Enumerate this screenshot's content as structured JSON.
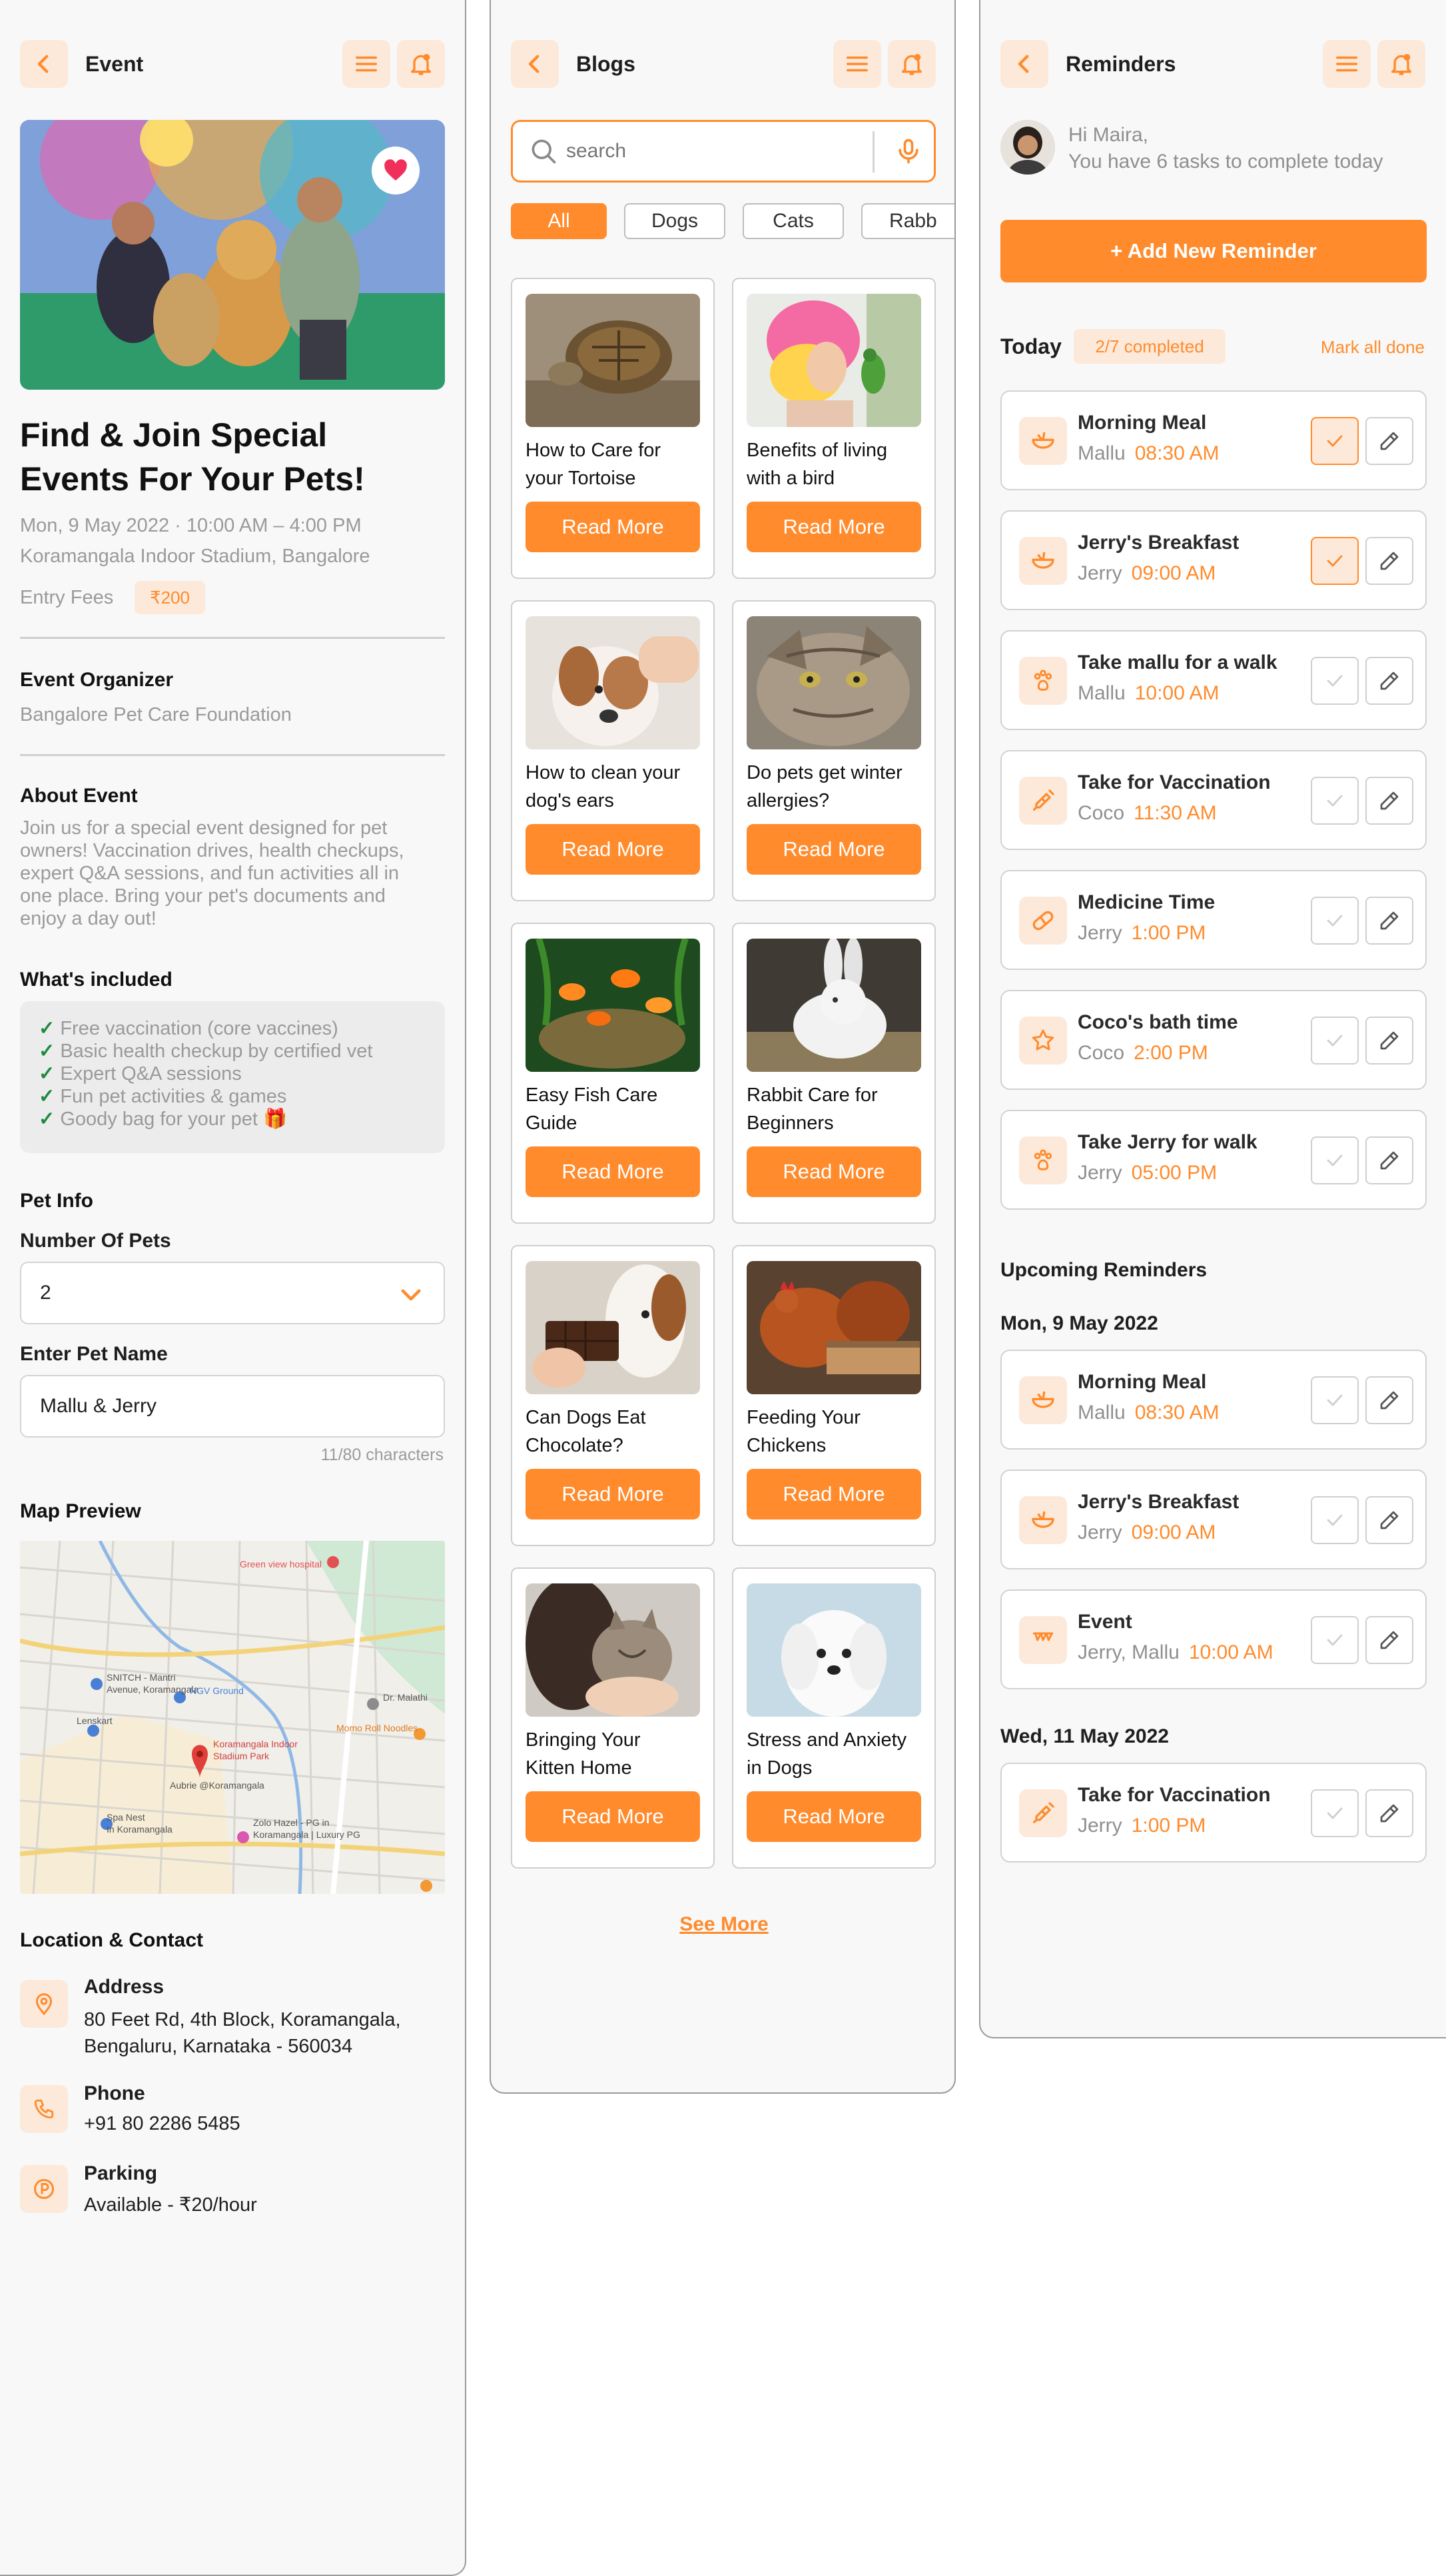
{
  "colors": {
    "accent": "#ff8b2c",
    "accent_light": "#fde9da",
    "success": "#1e8a3e",
    "muted": "#9a9a9a"
  },
  "event": {
    "nav_title": "Event",
    "title_line1": "Find & Join Special",
    "title_line2": "Events For Your Pets!",
    "datetime": "Mon, 9 May 2022 · 10:00 AM – 4:00 PM",
    "venue": "Koramangala Indoor Stadium, Bangalore",
    "entry_label": "Entry Fees",
    "entry_fee": "₹200",
    "organizer_heading": "Event Organizer",
    "organizer_name": "Bangalore Pet Care Foundation",
    "about_heading": "About Event",
    "about_lines": [
      "Join us for a special event designed for pet",
      "owners! Vaccination drives, health checkups,",
      "expert Q&A sessions, and fun activities all in",
      "one place. Bring your pet's documents and",
      "enjoy a day out!"
    ],
    "included_heading": "What's included",
    "included": [
      "Free vaccination (core vaccines)",
      "Basic health checkup by certified vet",
      "Expert Q&A sessions",
      "Fun pet activities & games",
      "Goody bag for your pet 🎁"
    ],
    "pet_info_heading": "Pet Info",
    "num_pets_label": "Number Of Pets",
    "num_pets_value": "2",
    "pet_name_label": "Enter Pet Name",
    "pet_name_value": "Mallu & Jerry",
    "char_count": "11/80 characters",
    "map_heading": "Map Preview",
    "map_labels": {
      "hospital": "Green view hospital",
      "snitch": "SNITCH - Mantri",
      "snitch2": "Avenue, Koramangala",
      "ngv": "NGV Ground",
      "lenskart": "Lenskart",
      "stadium": "Koramangala Indoor",
      "stadium2": "Stadium Park",
      "aubrie": "Aubrie @Koramangala",
      "momo": "Momo Roll Noodles",
      "spa": "Spa Nest",
      "spa2": "In Koramangala",
      "zolo": "Zolo Hazel - PG in",
      "zolo2": "Koramangala | Luxury PG",
      "dr": "Dr. Malathi"
    },
    "contact_heading": "Location & Contact",
    "address_label": "Address",
    "address_line1": "80 Feet Rd, 4th Block, Koramangala,",
    "address_line2": "Bengaluru, Karnataka - 560034",
    "phone_label": "Phone",
    "phone_value": "+91 80 2286 5485",
    "parking_label": "Parking",
    "parking_value": "Available - ₹20/hour"
  },
  "blogs": {
    "nav_title": "Blogs",
    "search_placeholder": "search",
    "chips": [
      "All",
      "Dogs",
      "Cats",
      "Rabb"
    ],
    "read_more": "Read More",
    "see_more": "See More",
    "cards": [
      {
        "title": [
          "How to Care for",
          "your Tortoise"
        ]
      },
      {
        "title": [
          "Benefits of living",
          "with a bird"
        ]
      },
      {
        "title": [
          "How to clean your",
          "dog's ears"
        ]
      },
      {
        "title": [
          "Do pets get winter",
          "allergies?"
        ]
      },
      {
        "title": [
          "Easy Fish Care",
          "Guide"
        ]
      },
      {
        "title": [
          "Rabbit Care for",
          "Beginners"
        ]
      },
      {
        "title": [
          "Can Dogs Eat",
          "Chocolate?"
        ]
      },
      {
        "title": [
          "Feeding Your",
          "Chickens"
        ]
      },
      {
        "title": [
          "Bringing Your",
          "Kitten Home"
        ]
      },
      {
        "title": [
          "Stress and Anxiety",
          "in Dogs"
        ]
      }
    ]
  },
  "reminders": {
    "nav_title": "Reminders",
    "greeting": "Hi Maira,",
    "subtitle": "You have 6 tasks to complete today",
    "add_button": "+ Add New Reminder",
    "today_label": "Today",
    "completed_badge": "2/7 completed",
    "mark_all": "Mark all done",
    "today": [
      {
        "title": "Morning Meal",
        "pet": "Mallu",
        "time": "08:30 AM",
        "icon": "bowl-icon",
        "done": true
      },
      {
        "title": "Jerry's Breakfast",
        "pet": "Jerry",
        "time": "09:00 AM",
        "icon": "bowl-icon",
        "done": true
      },
      {
        "title": "Take mallu for a walk",
        "pet": "Mallu",
        "time": "10:00 AM",
        "icon": "paw-icon",
        "done": false
      },
      {
        "title": "Take for Vaccination",
        "pet": "Coco",
        "time": "11:30 AM",
        "icon": "syringe-icon",
        "done": false
      },
      {
        "title": "Medicine Time",
        "pet": "Jerry",
        "time": "1:00 PM",
        "icon": "pill-icon",
        "done": false
      },
      {
        "title": "Coco's bath time",
        "pet": "Coco",
        "time": "2:00 PM",
        "icon": "star-icon",
        "done": false
      },
      {
        "title": "Take Jerry for walk",
        "pet": "Jerry",
        "time": "05:00 PM",
        "icon": "paw-icon",
        "done": false
      }
    ],
    "upcoming_heading": "Upcoming Reminders",
    "upcoming_date1": "Mon, 9 May 2022",
    "upcoming1": [
      {
        "title": "Morning Meal",
        "pet": "Mallu",
        "time": "08:30 AM",
        "icon": "bowl-icon"
      },
      {
        "title": "Jerry's Breakfast",
        "pet": "Jerry",
        "time": "09:00 AM",
        "icon": "bowl-icon"
      },
      {
        "title": "Event",
        "pet": "Jerry, Mallu",
        "time": "10:00 AM",
        "icon": "party-icon"
      }
    ],
    "upcoming_date2": "Wed, 11 May 2022",
    "upcoming2": [
      {
        "title": "Take for Vaccination",
        "pet": "Jerry",
        "time": "1:00 PM",
        "icon": "syringe-icon"
      }
    ]
  }
}
